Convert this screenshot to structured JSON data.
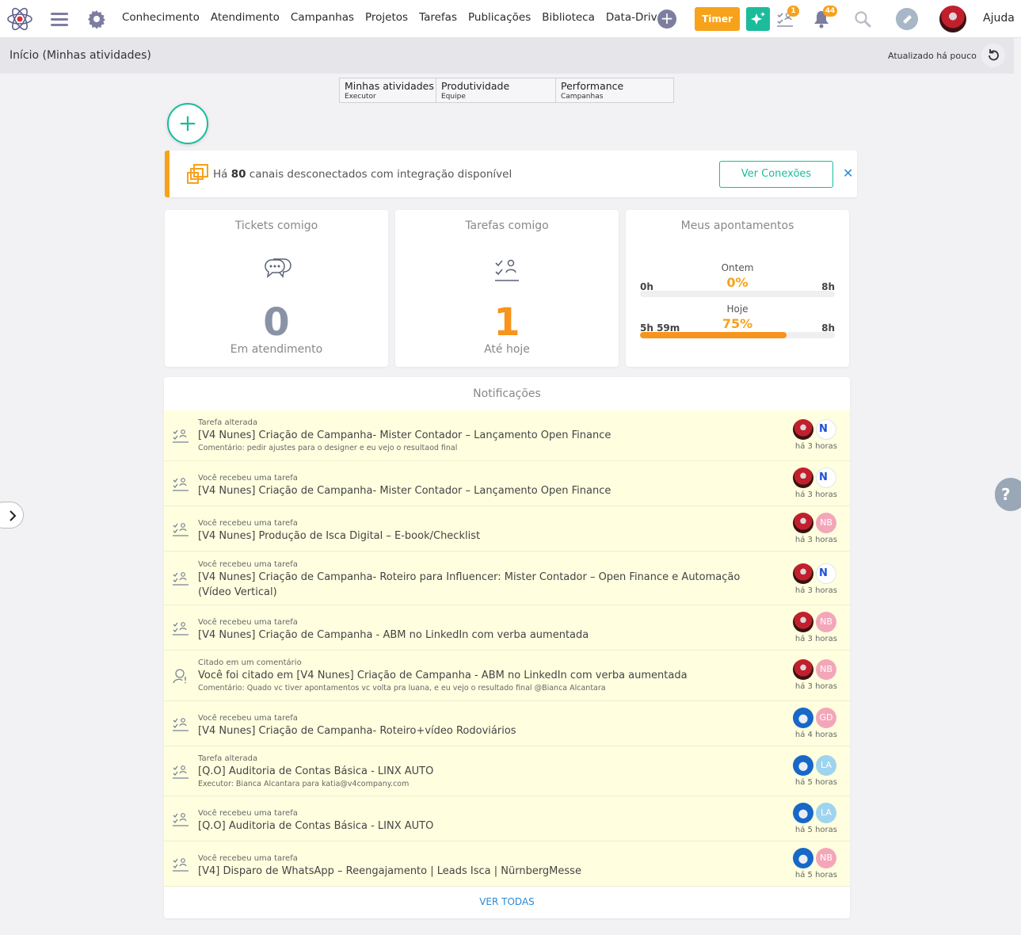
{
  "nav": {
    "items": [
      "Conhecimento",
      "Atendimento",
      "Campanhas",
      "Projetos",
      "Tarefas",
      "Publicações",
      "Biblioteca",
      "Data-Driven"
    ],
    "timer_label": "Timer",
    "tasks_badge": "1",
    "notifications_badge": "44",
    "help_label": "Ajuda"
  },
  "subbar": {
    "title": "Início (Minhas atividades)",
    "updated": "Atualizado há pouco"
  },
  "tabs": [
    {
      "label": "Minhas atividades",
      "sub": "Executor"
    },
    {
      "label": "Produtividade",
      "sub": "Equipe"
    },
    {
      "label": "Performance",
      "sub": "Campanhas"
    }
  ],
  "alert": {
    "prefix": "Há ",
    "count": "80",
    "suffix": " canais desconectados com integração disponível",
    "button": "Ver Conexões",
    "close": "✕"
  },
  "cards": {
    "tickets": {
      "title": "Tickets comigo",
      "value": "0",
      "sub": "Em atendimento",
      "color": "#8a92a6"
    },
    "tasks": {
      "title": "Tarefas comigo",
      "value": "1",
      "sub": "Até hoje",
      "color": "#f7941d"
    },
    "appointments": {
      "title": "Meus apontamentos",
      "rows": [
        {
          "label": "Ontem",
          "percent": "0%",
          "low": "0h",
          "high": "8h",
          "fraction": 0
        },
        {
          "label": "Hoje",
          "percent": "75%",
          "low": "5h 59m",
          "high": "8h",
          "fraction": 0.75
        }
      ]
    }
  },
  "notifications": {
    "title": "Notificações",
    "see_all": "VER TODAS",
    "items": [
      {
        "type": "Tarefa alterada",
        "title": "[V4 Nunes] Criação de Campanha- Mister Contador – Lançamento Open Finance",
        "detail": "Comentário: pedir ajustes para o designer e eu vejo o resultaod final",
        "time": "há 3 horas",
        "icon": "task-icon",
        "avatars": [
          "red",
          "logo"
        ],
        "initials": [
          "",
          ""
        ]
      },
      {
        "type": "Você recebeu uma tarefa",
        "title": "[V4 Nunes] Criação de Campanha- Mister Contador – Lançamento Open Finance",
        "detail": "",
        "time": "há 3 horas",
        "icon": "task-icon",
        "avatars": [
          "red",
          "logo"
        ],
        "initials": [
          "",
          ""
        ]
      },
      {
        "type": "Você recebeu uma tarefa",
        "title": "[V4 Nunes] Produção de Isca Digital – E-book/Checklist",
        "detail": "",
        "time": "há 3 horas",
        "icon": "task-icon",
        "avatars": [
          "red",
          "pink"
        ],
        "initials": [
          "",
          "NB"
        ]
      },
      {
        "type": "Você recebeu uma tarefa",
        "title": "[V4 Nunes] Criação de Campanha- Roteiro para Influencer: Mister Contador – Open Finance e Automação (Vídeo Vertical)",
        "detail": "",
        "time": "há 3 horas",
        "icon": "task-icon",
        "avatars": [
          "red",
          "logo"
        ],
        "initials": [
          "",
          ""
        ]
      },
      {
        "type": "Você recebeu uma tarefa",
        "title": "[V4 Nunes] Criação de Campanha - ABM no LinkedIn com verba aumentada",
        "detail": "",
        "time": "há 3 horas",
        "icon": "task-icon",
        "avatars": [
          "red",
          "pink"
        ],
        "initials": [
          "",
          "NB"
        ]
      },
      {
        "type": "Citado em um comentário",
        "title": "Você foi citado em [V4 Nunes] Criação de Campanha - ABM no LinkedIn com verba aumentada",
        "detail": "Comentário: Quado vc tiver apontamentos vc volta pra luana, e eu vejo o resultado final @Bianca Alcantara",
        "time": "há 3 horas",
        "icon": "mention-icon",
        "avatars": [
          "red",
          "pink"
        ],
        "initials": [
          "",
          "NB"
        ]
      },
      {
        "type": "Você recebeu uma tarefa",
        "title": "[V4 Nunes] Criação de Campanha- Roteiro+vídeo Rodoviários",
        "detail": "",
        "time": "há 4 horas",
        "icon": "task-icon",
        "avatars": [
          "blue",
          "pink"
        ],
        "initials": [
          "",
          "GD"
        ]
      },
      {
        "type": "Tarefa alterada",
        "title": "[Q.O] Auditoria de Contas Básica - LINX AUTO",
        "detail": "Executor: Bianca Alcantara para katia@v4company.com",
        "time": "há 5 horas",
        "icon": "task-icon",
        "avatars": [
          "blue",
          "lblue"
        ],
        "initials": [
          "",
          "LA"
        ]
      },
      {
        "type": "Você recebeu uma tarefa",
        "title": "[Q.O] Auditoria de Contas Básica - LINX AUTO",
        "detail": "",
        "time": "há 5 horas",
        "icon": "task-icon",
        "avatars": [
          "blue",
          "lblue"
        ],
        "initials": [
          "",
          "LA"
        ]
      },
      {
        "type": "Você recebeu uma tarefa",
        "title": "[V4] Disparo de WhatsApp – Reengajamento | Leads Isca | NürnbergMesse",
        "detail": "",
        "time": "há 5 horas",
        "icon": "task-icon",
        "avatars": [
          "blue",
          "pink"
        ],
        "initials": [
          "",
          "NB"
        ]
      }
    ]
  },
  "colors": {
    "accent": "#1bbc9b",
    "warning": "#f7a21b",
    "link": "#2a8ad6"
  },
  "help_float": "?"
}
